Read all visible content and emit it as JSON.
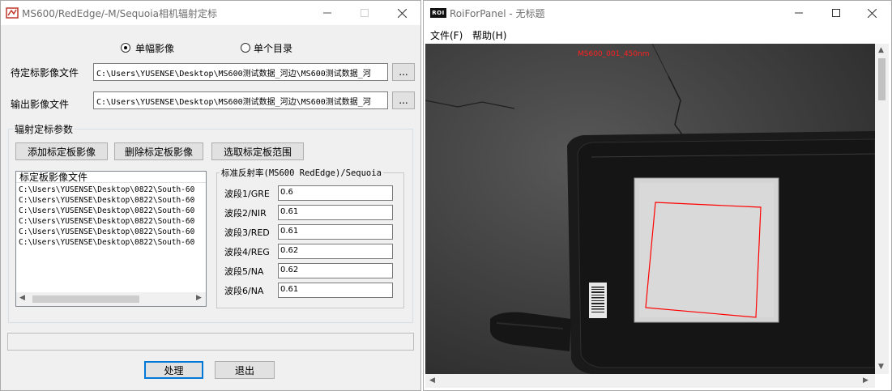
{
  "left_window": {
    "title": "MS600/RedEdge/-M/Sequoia相机辐射定标",
    "mode_options": [
      {
        "label": "单幅影像",
        "selected": true
      },
      {
        "label": "单个目录",
        "selected": false
      }
    ],
    "input_label": "待定标影像文件",
    "input_value": "C:\\Users\\YUSENSE\\Desktop\\MS600测试数据_河边\\MS600测试数据_河",
    "output_label": "输出影像文件",
    "output_value": "C:\\Users\\YUSENSE\\Desktop\\MS600测试数据_河边\\MS600测试数据_河",
    "browse_label": "...",
    "group_title": "辐射定标参数",
    "buttons": {
      "add": "添加标定板影像",
      "delete": "删除标定板影像",
      "select_range": "选取标定板范围",
      "process": "处理",
      "exit": "退出"
    },
    "list_header": "标定板影像文件",
    "list_items": [
      "C:\\Users\\YUSENSE\\Desktop\\0822\\South-60",
      "C:\\Users\\YUSENSE\\Desktop\\0822\\South-60",
      "C:\\Users\\YUSENSE\\Desktop\\0822\\South-60",
      "C:\\Users\\YUSENSE\\Desktop\\0822\\South-60",
      "C:\\Users\\YUSENSE\\Desktop\\0822\\South-60",
      "C:\\Users\\YUSENSE\\Desktop\\0822\\South-60"
    ],
    "reflectance_title": "标准反射率(MS600 RedEdge)/Sequoia",
    "bands": [
      {
        "label": "波段1/GRE",
        "value": "0.6"
      },
      {
        "label": "波段2/NIR",
        "value": "0.61"
      },
      {
        "label": "波段3/RED",
        "value": "0.61"
      },
      {
        "label": "波段4/REG",
        "value": "0.62"
      },
      {
        "label": "波段5/NA",
        "value": "0.62"
      },
      {
        "label": "波段6/NA",
        "value": "0.61"
      }
    ]
  },
  "right_window": {
    "app_icon_text": "ROI",
    "title": "RoiForPanel - 无标题",
    "menu": [
      "文件(F)",
      "帮助(H)"
    ],
    "image_label": "MS600_001_450nm"
  },
  "colors": {
    "accent": "#0078d7",
    "roi": "#ff0000",
    "window_bg": "#f0f0f0"
  }
}
